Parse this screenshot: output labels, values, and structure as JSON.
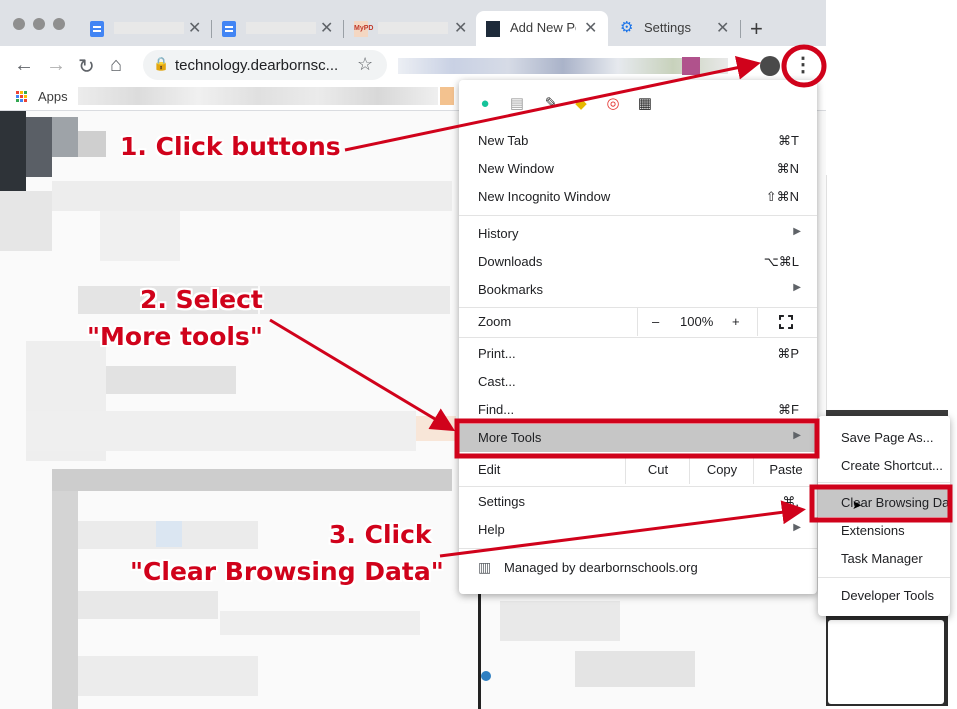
{
  "tabs": [
    {
      "title": "",
      "icon": "google-docs-icon"
    },
    {
      "title": "",
      "icon": "google-docs-icon"
    },
    {
      "title": "",
      "icon": "mypd-icon"
    },
    {
      "title": "Add New Po",
      "icon": "wordpress-icon",
      "active": true
    },
    {
      "title": "Settings",
      "icon": "settings-gear-icon"
    }
  ],
  "toolbar": {
    "url": "technology.dearbornsc..."
  },
  "bookmarks": {
    "apps_label": "Apps"
  },
  "menu": {
    "items": {
      "new_tab": {
        "label": "New Tab",
        "shortcut": "⌘T"
      },
      "new_window": {
        "label": "New Window",
        "shortcut": "⌘N"
      },
      "incognito": {
        "label": "New Incognito Window",
        "shortcut": "⇧⌘N"
      },
      "history": {
        "label": "History"
      },
      "downloads": {
        "label": "Downloads",
        "shortcut": "⌥⌘L"
      },
      "bookmarks": {
        "label": "Bookmarks"
      },
      "print": {
        "label": "Print...",
        "shortcut": "⌘P"
      },
      "cast": {
        "label": "Cast..."
      },
      "find": {
        "label": "Find...",
        "shortcut": "⌘F"
      },
      "more_tools": {
        "label": "More Tools"
      },
      "settings": {
        "label": "Settings",
        "shortcut": "⌘,"
      },
      "help": {
        "label": "Help"
      }
    },
    "zoom": {
      "label": "Zoom",
      "minus": "–",
      "value": "100%",
      "plus": "+"
    },
    "edit": {
      "label": "Edit",
      "cut": "Cut",
      "copy": "Copy",
      "paste": "Paste"
    },
    "managed": "Managed by dearbornschools.org"
  },
  "submenu": [
    {
      "label": "Save Page As..."
    },
    {
      "label": "Create Shortcut..."
    },
    {
      "label": "Clear Browsing Data..."
    },
    {
      "label": "Extensions"
    },
    {
      "label": "Task Manager"
    },
    {
      "label": "Developer Tools"
    }
  ],
  "annotations": {
    "step1": "1. Click buttons",
    "step2_line1": "2. Select",
    "step2_line2": "\"More tools\"",
    "step3_line1": "3. Click",
    "step3_line2": "\"Clear Browsing Data\""
  },
  "colors": {
    "annotation_red": "#d0021b",
    "menu_highlight": "#c6c6c6",
    "tabbar": "#dee1e6"
  }
}
